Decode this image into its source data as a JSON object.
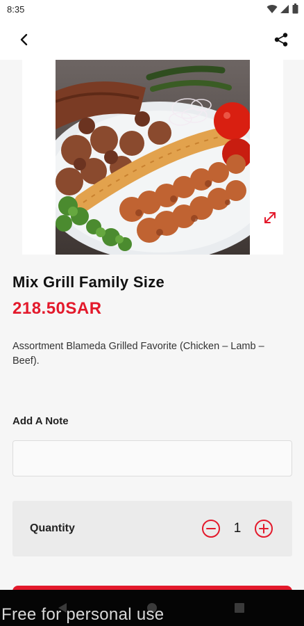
{
  "status": {
    "time": "8:35"
  },
  "product": {
    "name": "Mix Grill Family Size",
    "price": "218.50SAR",
    "description": "Assortment Blameda Grilled Favorite (Chicken – Lamb – Beef)."
  },
  "note": {
    "label": "Add A Note",
    "value": "",
    "placeholder": ""
  },
  "quantity": {
    "label": "Quantity",
    "value": "1"
  },
  "icons": {
    "back": "back-arrow-icon",
    "share": "share-icon",
    "expand": "expand-icon",
    "minus": "minus-circle-icon",
    "plus": "plus-circle-icon"
  },
  "colors": {
    "accent": "#e3192b",
    "background": "#f6f6f6"
  },
  "watermark": "Free for personal use"
}
